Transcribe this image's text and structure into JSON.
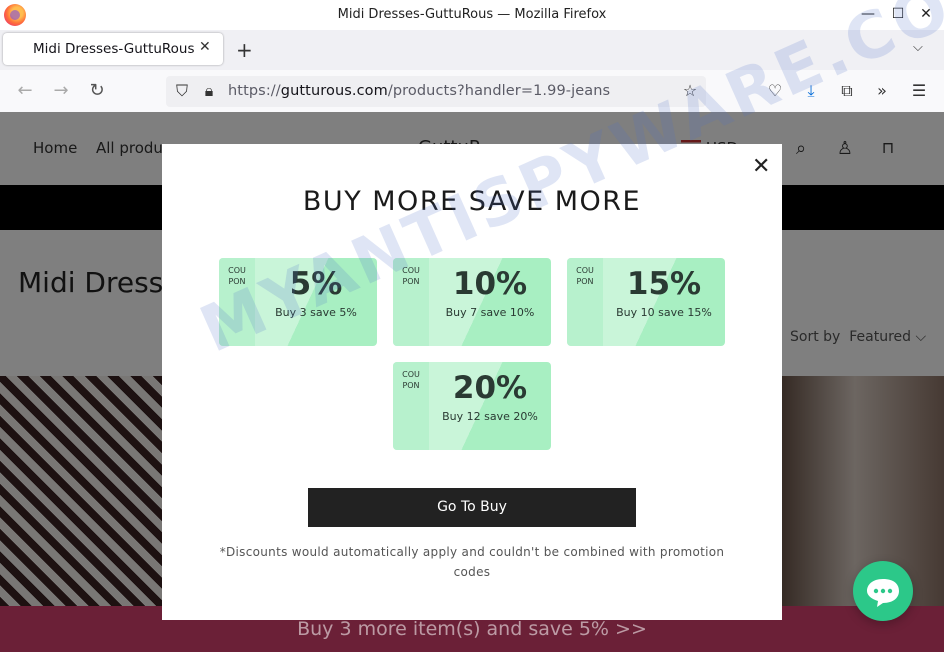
{
  "window": {
    "title": "Midi Dresses-GuttuRous — Mozilla Firefox"
  },
  "tab": {
    "title": "Midi Dresses-GuttuRous"
  },
  "address": {
    "scheme": "https://",
    "host": "gutturous.com",
    "path": "/products?handler=1.99-jeans"
  },
  "site": {
    "nav": [
      "Home",
      "All produc"
    ],
    "logo_partial": "GuttuR",
    "currency_partial": "USD",
    "page_title": "Midi Dress",
    "sort_label": "Sort by",
    "sort_value": "Featured"
  },
  "promo_bar": {
    "text": "Buy 3 more item(s) and save 5%  >>"
  },
  "modal": {
    "title": "BUY MORE SAVE MORE",
    "coupons": [
      {
        "label": "COUPON",
        "percent": "5%",
        "desc": "Buy 3 save 5%"
      },
      {
        "label": "COUPON",
        "percent": "10%",
        "desc": "Buy 7 save 10%"
      },
      {
        "label": "COUPON",
        "percent": "15%",
        "desc": "Buy 10 save 15%"
      },
      {
        "label": "COUPON",
        "percent": "20%",
        "desc": "Buy 12 save 20%"
      }
    ],
    "button": "Go To Buy",
    "disclaimer": "*Discounts would automatically apply and couldn't be combined with promotion codes"
  },
  "watermark": "MYANTISPYWARE.COM",
  "colors": {
    "accent": "#d6416e",
    "coupon": "#c9f5d9",
    "chat": "#2cc889"
  }
}
